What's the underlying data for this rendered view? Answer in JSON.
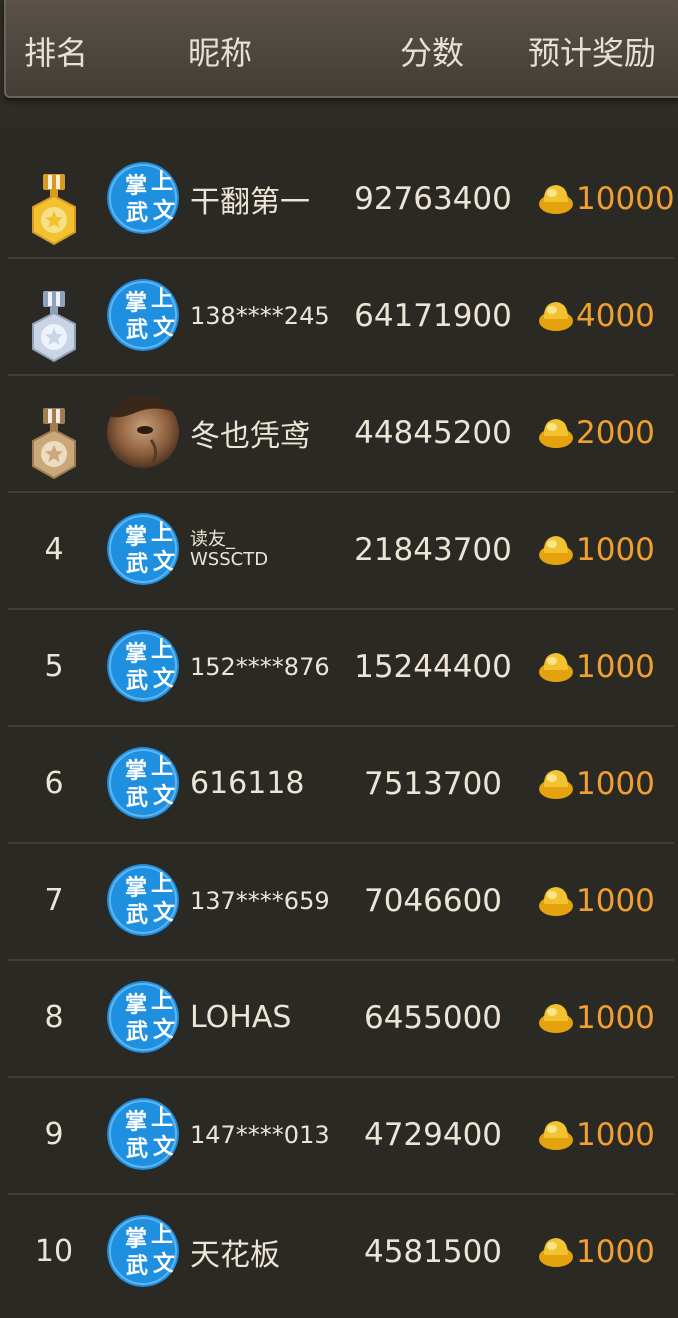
{
  "header": {
    "rank_label": "排名",
    "name_label": "昵称",
    "score_label": "分数",
    "reward_label": "预计奖励"
  },
  "avatar_text": [
    "掌",
    "上",
    "武",
    "文"
  ],
  "colors": {
    "gold": "#f2c230",
    "silver": "#c9d4e4",
    "bronze": "#c9a879",
    "reward": "#f0a030",
    "avatar_blue": "#1f8fe0"
  },
  "rows": [
    {
      "rank": "1",
      "medal": "gold",
      "avatar": "zhangshang",
      "name": "干翻第一",
      "score": "92763400",
      "reward": "10000"
    },
    {
      "rank": "2",
      "medal": "silver",
      "avatar": "zhangshang",
      "name": "138****245",
      "score": "64171900",
      "reward": "4000"
    },
    {
      "rank": "3",
      "medal": "bronze",
      "avatar": "photo",
      "name": "冬也凭鸢",
      "score": "44845200",
      "reward": "2000"
    },
    {
      "rank": "4",
      "medal": "",
      "avatar": "zhangshang",
      "name": "读友_ WSSCTD",
      "name_line1": "读友_",
      "name_line2": "WSSCTD",
      "score": "21843700",
      "reward": "1000"
    },
    {
      "rank": "5",
      "medal": "",
      "avatar": "zhangshang",
      "name": "152****876",
      "score": "15244400",
      "reward": "1000"
    },
    {
      "rank": "6",
      "medal": "",
      "avatar": "zhangshang",
      "name": "616118",
      "score": "7513700",
      "reward": "1000"
    },
    {
      "rank": "7",
      "medal": "",
      "avatar": "zhangshang",
      "name": "137****659",
      "score": "7046600",
      "reward": "1000"
    },
    {
      "rank": "8",
      "medal": "",
      "avatar": "zhangshang",
      "name": "LOHAS",
      "score": "6455000",
      "reward": "1000"
    },
    {
      "rank": "9",
      "medal": "",
      "avatar": "zhangshang",
      "name": "147****013",
      "score": "4729400",
      "reward": "1000"
    },
    {
      "rank": "10",
      "medal": "",
      "avatar": "zhangshang",
      "name": "天花板",
      "score": "4581500",
      "reward": "1000"
    }
  ]
}
